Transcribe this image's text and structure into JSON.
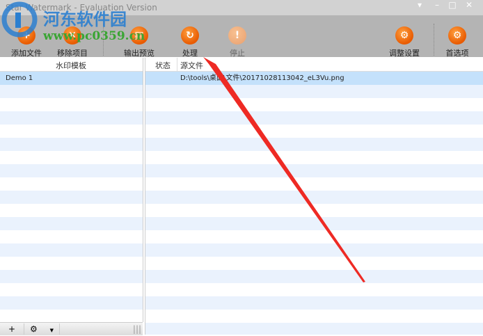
{
  "window": {
    "title": "Star Watermark - Evaluation Version"
  },
  "toolbar": [
    {
      "label": "添加文件",
      "icon": "add-file-icon"
    },
    {
      "label": "移除项目",
      "icon": "remove-icon"
    },
    {
      "label": "输出预览",
      "icon": "preview-icon"
    },
    {
      "label": "处理",
      "icon": "process-icon"
    },
    {
      "label": "停止",
      "icon": "stop-icon"
    },
    {
      "label": "调整设置",
      "icon": "settings-icon"
    },
    {
      "label": "首选项",
      "icon": "preferences-icon"
    }
  ],
  "left_panel": {
    "header": "水印模板",
    "items": [
      "Demo 1"
    ]
  },
  "right_panel": {
    "columns": [
      "状态",
      "源文件"
    ],
    "rows": [
      {
        "status": "",
        "source": "D:\\tools\\桌面\\文件\\20171028113042_eL3Vu.png"
      }
    ]
  },
  "watermark": {
    "name": "河东软件园",
    "url": "www.pc0359.cn"
  },
  "colors": {
    "accent": "#e85a00",
    "selection": "#c4e1fb",
    "stripe": "#eaf2fd",
    "arrow": "#ee2a24"
  }
}
